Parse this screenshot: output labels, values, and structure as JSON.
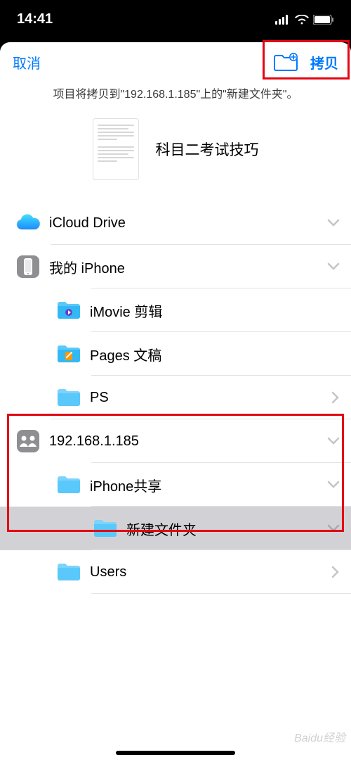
{
  "status": {
    "time": "14:41"
  },
  "nav": {
    "cancel": "取消",
    "copy": "拷贝"
  },
  "subtitle": "项目将拷贝到\"192.168.1.185\"上的\"新建文件夹\"。",
  "file": {
    "name": "科目二考试技巧"
  },
  "locations": {
    "icloud": "iCloud Drive",
    "iphone": "我的 iPhone",
    "imovie": "iMovie 剪辑",
    "pages": "Pages 文稿",
    "ps": "PS",
    "server": "192.168.1.185",
    "share": "iPhone共享",
    "newfolder": "新建文件夹",
    "users": "Users"
  },
  "colors": {
    "accent": "#007aff",
    "folder": "#5ac8fa",
    "highlight": "#e30613"
  },
  "watermark": "Baidu经验"
}
